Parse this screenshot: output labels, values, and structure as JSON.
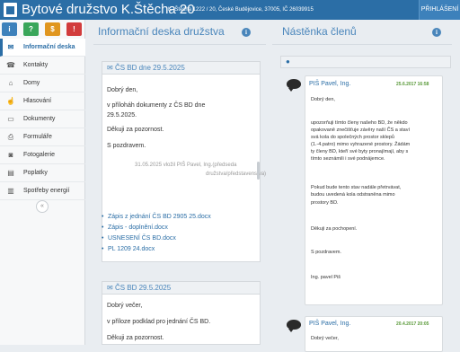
{
  "header": {
    "title": "Bytové družstvo K.Štěcha 20",
    "subtitle": "K. Štěcha 1222 / 20, České Budějovice, 37005, IČ 26039915",
    "login_label": "PŘIHLÁŠENÍ"
  },
  "quick_buttons": [
    {
      "label": "i",
      "color": "#3d81bb"
    },
    {
      "label": "?",
      "color": "#3aa65a"
    },
    {
      "label": "$",
      "color": "#e0961f"
    },
    {
      "label": "!",
      "color": "#d23c3c"
    }
  ],
  "sidebar": {
    "items": [
      {
        "label": "Informační deska",
        "icon": "envelope-icon",
        "glyph": "✉",
        "active": true
      },
      {
        "label": "Kontakty",
        "icon": "phone-icon",
        "glyph": "☎"
      },
      {
        "label": "Domy",
        "icon": "home-icon",
        "glyph": "⌂"
      },
      {
        "label": "Hlasování",
        "icon": "hand-icon",
        "glyph": "☝"
      },
      {
        "label": "Dokumenty",
        "icon": "folder-icon",
        "glyph": "▭"
      },
      {
        "label": "Formuláře",
        "icon": "print-icon",
        "glyph": "⎙"
      },
      {
        "label": "Fotogalerie",
        "icon": "camera-icon",
        "glyph": "◙"
      },
      {
        "label": "Poplatky",
        "icon": "money-icon",
        "glyph": "▤"
      },
      {
        "label": "Spotřeby energií",
        "icon": "chart-icon",
        "glyph": "▥"
      }
    ],
    "collapse_label": "«"
  },
  "board": {
    "heading": "Informační deska družstva",
    "posts": [
      {
        "title": "ČS BD dne 29.5.2025",
        "lines": [
          "Dobrý den,",
          "v příloháh dokumenty z ČS BD dne",
          "29.5.2025.",
          "Děkuji za pozornost.",
          "S pozdravem."
        ],
        "signature": [
          "31.05.2025 vložil PIŠ Pavel, Ing.(předseda",
          "družstva/představenstva)"
        ],
        "attachments": [
          "Zápis z jednání ČS BD 2905 25.docx",
          "Zápis - doplnění.docx",
          "USNESENÍ ČS BD.docx",
          "PL 1209 24.docx"
        ]
      },
      {
        "title": "ČS BD 29.5.2025",
        "lines": [
          "Dobrý večer,",
          "v příloze podklad pro jednání ČS BD.",
          "Děkuji za pozornost."
        ]
      }
    ]
  },
  "wall": {
    "heading": "Nástěnka členů",
    "messages": [
      {
        "author": "PIŠ Pavel, Ing.",
        "date": "25.6.2017 16:58",
        "lines": [
          "Dobrý den,",
          "",
          "upozorňuji tímto členy našeho BD, že někdo",
          "opakovaně znečišťuje závěry naší ČS a staví",
          "svá kola do společných prostor sklepů",
          "(1.-4.patro) mimo vyhrazené prostory. Žádám",
          "ty členy BD, kteří své byty pronajímají, aby s",
          "tímto seznámili i své podnájemce.",
          "",
          "Pokud bude tento stav nadále přetrvávat,",
          "budou uvedená kola odstraněna mimo",
          "prostory BD.",
          "",
          "Děkuji za pochopení.",
          "",
          "S pozdravem.",
          "",
          "Ing. pavel Piš"
        ]
      },
      {
        "author": "PIŠ Pavel, Ing.",
        "date": "20.4.2017 20:05",
        "lines": [
          "Dobrý večer,"
        ]
      }
    ]
  }
}
